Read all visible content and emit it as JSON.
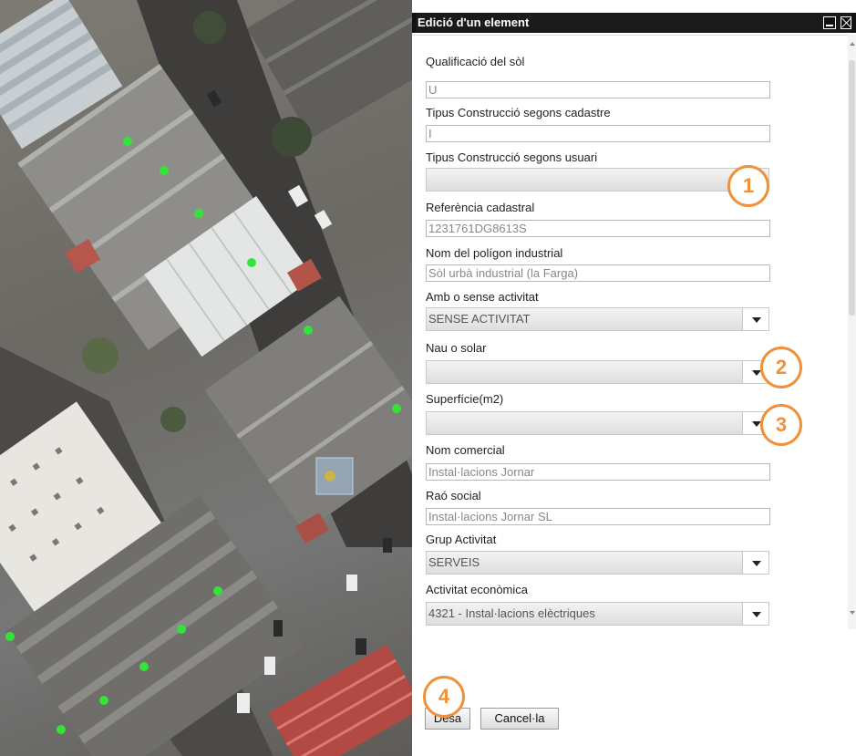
{
  "dialog": {
    "title": "Edició d'un element",
    "fields": {
      "qualificacio_label": "Qualificació del sòl",
      "qualificacio_value": "U",
      "tipus_cadastre_label": "Tipus Construcció segons cadastre",
      "tipus_cadastre_value": "I",
      "tipus_usuari_label": "Tipus Construcció segons usuari",
      "referencia_label": "Referència cadastral",
      "referencia_value": "1231761DG8613S",
      "poligon_label": "Nom del polígon industrial",
      "poligon_value": "Sòl urbà industrial (la Farga)",
      "activitat_label": "Amb o sense activitat",
      "activitat_value": "SENSE ACTIVITAT",
      "nau_label": "Nau o solar",
      "nau_value": "",
      "superficie_label": "Superfície(m2)",
      "superficie_value": "",
      "nom_comercial_label": "Nom comercial",
      "nom_comercial_value": "Instal·lacions Jornar",
      "rao_social_label": "Raó social",
      "rao_social_value": "Instal·lacions Jornar SL",
      "grup_label": "Grup Activitat",
      "grup_value": "SERVEIS",
      "activitat_economica_label": "Activitat econòmica",
      "activitat_economica_value": "4321 - Instal·lacions elèctriques"
    },
    "buttons": {
      "save": "Desa",
      "cancel": "Cancel·la"
    }
  },
  "callouts": [
    "1",
    "2",
    "3",
    "4"
  ],
  "colors": {
    "callout": "#f0913a",
    "map_marker": "#34e33a"
  }
}
